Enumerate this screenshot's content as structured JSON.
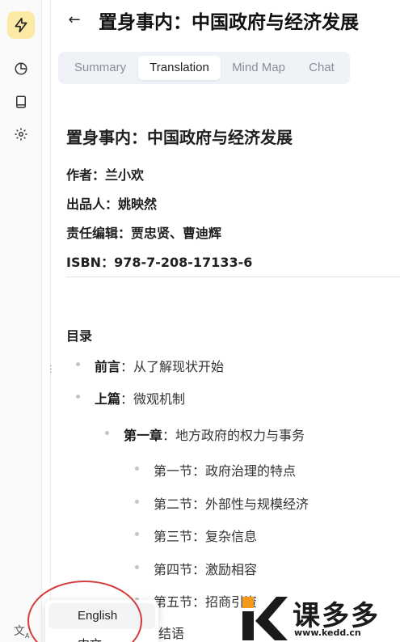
{
  "header": {
    "title": "置身事内：中国政府与经济发展"
  },
  "tabs": [
    {
      "label": "Summary",
      "active": false
    },
    {
      "label": "Translation",
      "active": true
    },
    {
      "label": "Mind Map",
      "active": false
    },
    {
      "label": "Chat",
      "active": false
    }
  ],
  "doc": {
    "title": "置身事内：中国政府与经济发展",
    "meta": [
      "作者：兰小欢",
      "出品人：姚映然",
      "责任编辑：贾忠贤、曹迪辉",
      "ISBN：978-7-208-17133-6"
    ]
  },
  "toc": {
    "heading": "目录",
    "items": [
      {
        "bold": "前言",
        "rest": "：从了解现状开始"
      },
      {
        "bold": "上篇",
        "rest": "：微观机制"
      },
      {
        "bold": "第一章",
        "rest": "：地方政府的权力与事务"
      },
      {
        "bold": "",
        "rest": "第一节：政府治理的特点"
      },
      {
        "bold": "",
        "rest": "第二节：外部性与规模经济"
      },
      {
        "bold": "",
        "rest": "第三节：复杂信息"
      },
      {
        "bold": "",
        "rest": "第四节：激励相容"
      },
      {
        "bold": "",
        "rest": "第五节：招商引资"
      }
    ],
    "tail": "结语"
  },
  "language_menu": {
    "selected": "English",
    "second": "中文"
  },
  "watermark": {
    "brand": "课多多",
    "url": "www.kedd.cn"
  },
  "colors": {
    "accent_logo_bg": "#fbe9a6",
    "annotation": "#d43b3b"
  }
}
